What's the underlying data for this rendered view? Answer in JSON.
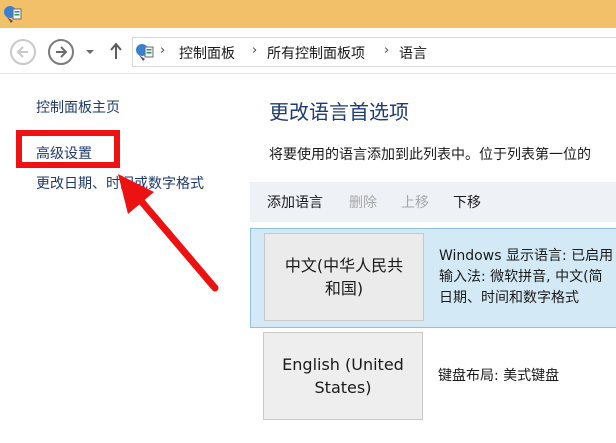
{
  "breadcrumb": [
    "控制面板",
    "所有控制面板项",
    "语言"
  ],
  "sidebar": {
    "items": [
      {
        "label": "控制面板主页"
      },
      {
        "label": "高级设置"
      },
      {
        "label": "更改日期、时间或数字格式"
      }
    ]
  },
  "main": {
    "heading": "更改语言首选项",
    "description": "将要使用的语言添加到此列表中。位于列表第一位的",
    "toolbar": {
      "add": "添加语言",
      "remove": "删除",
      "up": "上移",
      "down": "下移"
    },
    "languages": [
      {
        "name_line1": "中文(中华人民共",
        "name_line2": "和国)",
        "info": [
          "Windows 显示语言: 已启用",
          "输入法: 微软拼音, 中文(简",
          "日期、时间和数字格式"
        ]
      },
      {
        "name_line1": "English (United",
        "name_line2": "States)",
        "info": [
          "键盘布局: 美式键盘"
        ]
      }
    ]
  },
  "annotation": {
    "color": "#ee1111"
  },
  "colors": {
    "titlebar": "#f3c06a",
    "selected_row": "#d3e9f5",
    "link": "#1f3a6b",
    "heading": "#1d3c73"
  },
  "icons": {
    "app": "control-panel-icon",
    "back": "back-arrow-icon",
    "forward": "forward-arrow-icon",
    "recent": "chevron-down-icon",
    "up": "up-arrow-icon"
  }
}
